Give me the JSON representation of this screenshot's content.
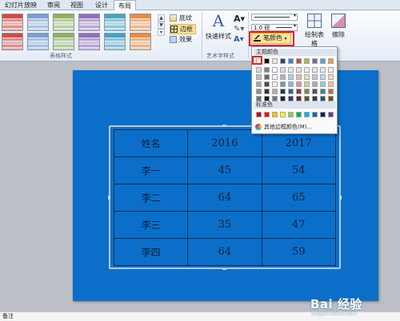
{
  "tabs": [
    "幻灯片放映",
    "审阅",
    "视图",
    "设计",
    "布局"
  ],
  "ribbon": {
    "shading_label": "底纹",
    "borders_label": "边框",
    "effects_label": "效果",
    "table_styles_group": "表格样式",
    "quick_styles_label": "快速样式",
    "wordart_group": "艺术字样式",
    "line_weight_value": "1.0 磅",
    "pen_color_label": "笔颜色",
    "draw_table_label": "绘制表格",
    "erase_label": "擦除"
  },
  "style_colors": [
    "#d04a43",
    "#7a9fd2",
    "#8fb35a",
    "#9070b8",
    "#46a3c3",
    "#eb8c3b"
  ],
  "dropdown": {
    "theme_colors_label": "主题颜色",
    "standard_colors_label": "标准色",
    "more_border_colors_label": "其他边框颜色(M)...",
    "theme_top_row": [
      "#ffffff",
      "#000000",
      "#e7e6e6",
      "#1f497d",
      "#4f81bd",
      "#c0504d",
      "#9bbb59",
      "#8064a2",
      "#4bacc6",
      "#f79646"
    ],
    "standard_colors": [
      "#c00000",
      "#ff0000",
      "#ffc000",
      "#ffff00",
      "#92d050",
      "#00b050",
      "#00b0f0",
      "#0070c0",
      "#002060",
      "#7030a0"
    ]
  },
  "table": {
    "header": [
      "姓名",
      "2016",
      "2017"
    ],
    "rows": [
      [
        "李一",
        "45",
        "54"
      ],
      [
        "李二",
        "64",
        "65"
      ],
      [
        "李三",
        "35",
        "47"
      ],
      [
        "李四",
        "64",
        "59"
      ]
    ]
  },
  "colors": {
    "slide_background": "#0b6fca",
    "highlight": "#fbe39b",
    "annotation_red": "#e02020"
  },
  "status": {
    "notes_label": "备注"
  },
  "watermark": {
    "brand": "Bai 经验",
    "url": "jingyan.baidu.com"
  }
}
